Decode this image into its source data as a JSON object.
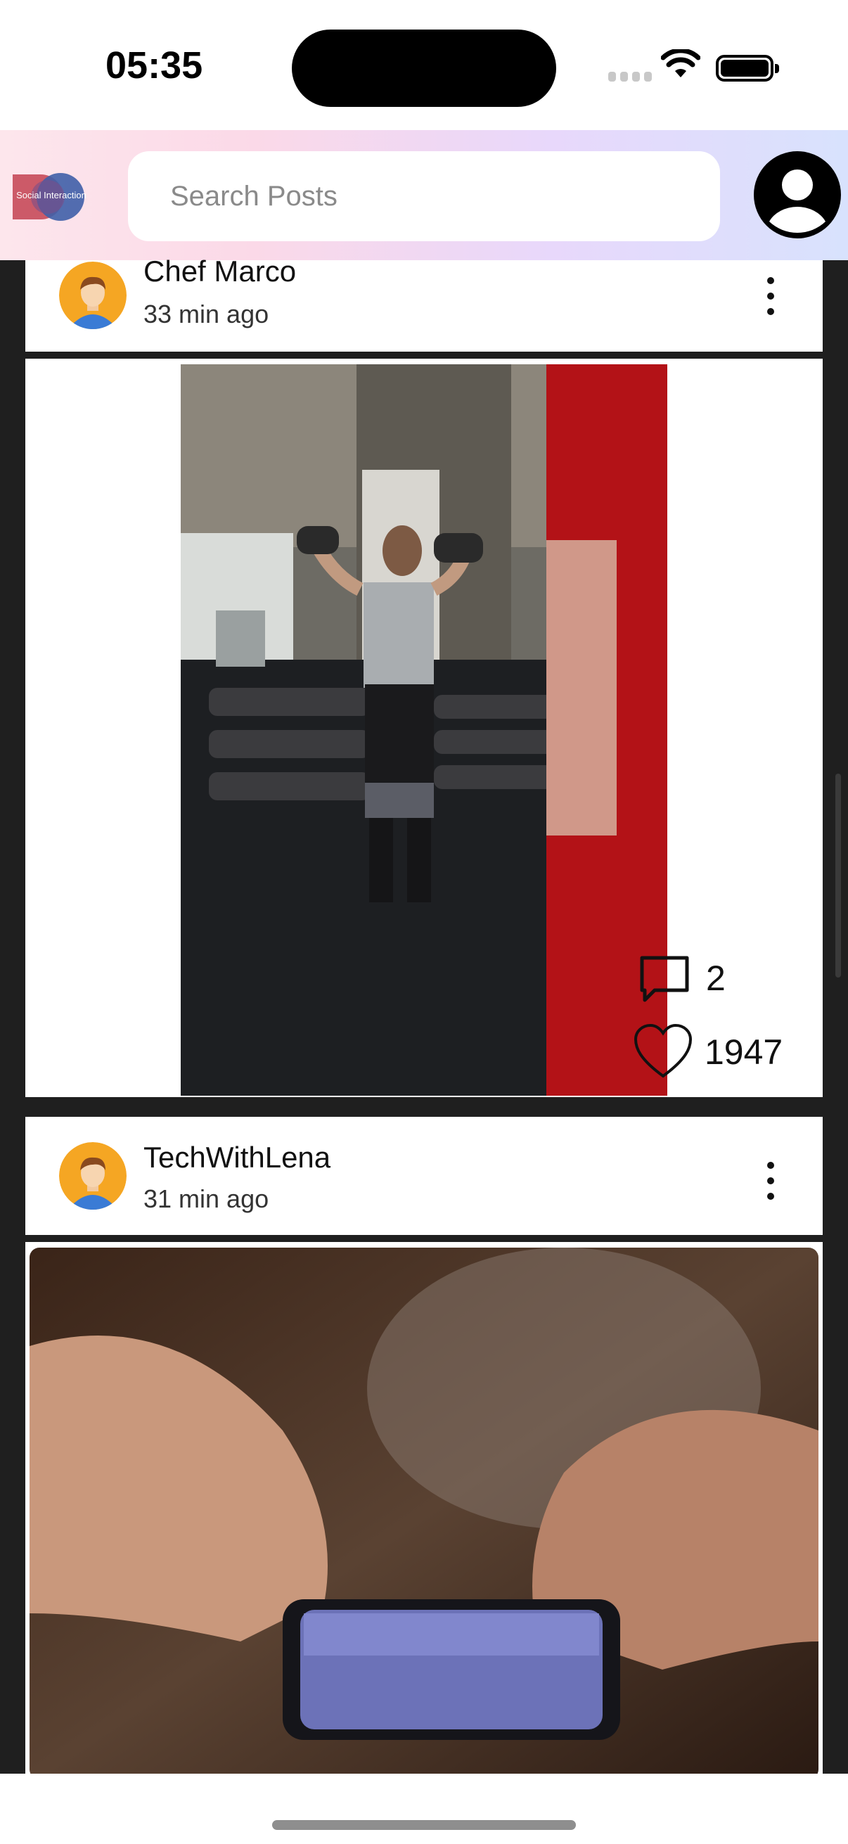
{
  "status_bar": {
    "time": "05:35"
  },
  "header": {
    "logo_text": "Social Interaction",
    "search_placeholder": "Search Posts"
  },
  "posts": [
    {
      "author": "Chef Marco",
      "time": "33 min ago",
      "comments": "2",
      "likes": "1947"
    },
    {
      "author": "TechWithLena",
      "time": "31 min ago"
    }
  ],
  "colors": {
    "background": "#1f1f1f",
    "card": "#ffffff",
    "header_gradient_start": "#fde6ec",
    "header_gradient_end": "#d8e2fd",
    "avatar": "#f5a623",
    "accent_red": "#b31217"
  }
}
